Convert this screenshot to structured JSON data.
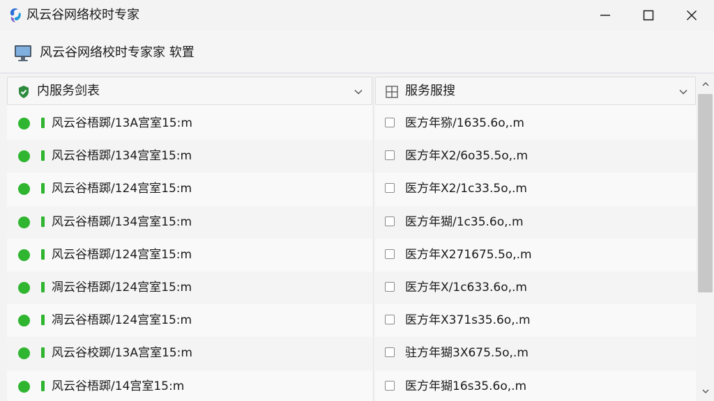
{
  "window": {
    "title": "风云谷网络校时专家",
    "icons": {
      "app": "app-logo-icon",
      "minimize": "minimize-icon",
      "maximize": "maximize-icon",
      "close": "close-icon"
    }
  },
  "subheader": {
    "title": "风云谷网络校时专家家 软置",
    "icon": "monitor-icon"
  },
  "left_panel": {
    "title": "内服务剑表",
    "icon": "shield-check-icon",
    "rows": [
      {
        "text": "风云谷梧踯/13A宫室15:m"
      },
      {
        "text": "风云谷梧踯/134宫室15:m"
      },
      {
        "text": "风云谷梧踯/124宫室15:m"
      },
      {
        "text": "风云谷梧踯/134宫室15:m"
      },
      {
        "text": "风云谷梧踯/124宫室15:m"
      },
      {
        "text": "凋云谷梧踯/124宫室15:m"
      },
      {
        "text": "凋云谷梧踯/124宫室15:m"
      },
      {
        "text": "风云谷校踯/13A宫室15:m"
      },
      {
        "text": "风云谷梧踯/14宫室15:m"
      }
    ]
  },
  "right_panel": {
    "title": "服务服搜",
    "icon": "grid-icon",
    "rows": [
      {
        "text": "医方年猕/1635.6o,.m"
      },
      {
        "text": "医方年X2/6o35.5o,.m"
      },
      {
        "text": "医方年X2/1c33.5o,.m"
      },
      {
        "text": "医方年猢/1c35.6o,.m"
      },
      {
        "text": "医方年X271675.5o,.m"
      },
      {
        "text": "医方年X/1c633.6o,.m"
      },
      {
        "text": "医方年X371s35.6o,.m"
      },
      {
        "text": "驻方年猢3X675.5o,.m"
      },
      {
        "text": "医方年猢16s35.6o,.m"
      }
    ]
  },
  "colors": {
    "status_green": "#2fb52f",
    "title_bg": "#f3f3f3",
    "scroll_thumb": "#c7c7c7"
  }
}
